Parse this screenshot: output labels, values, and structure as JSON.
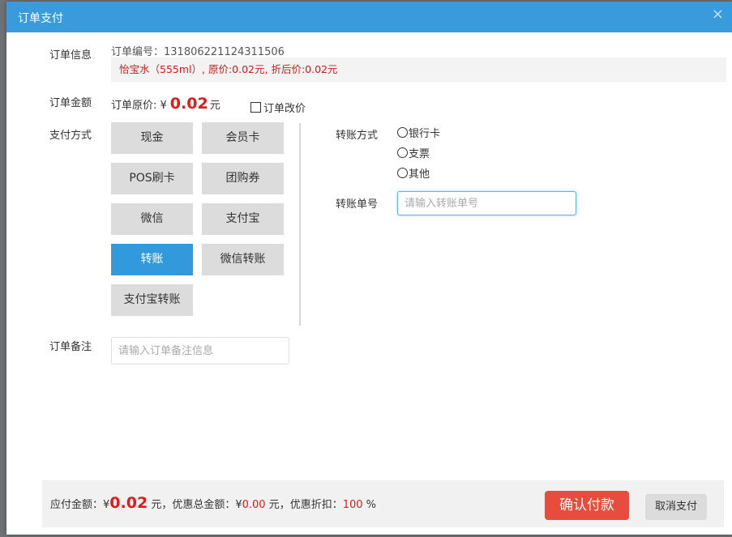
{
  "dialog": {
    "title": "订单支付",
    "close_icon": "×"
  },
  "order_info": {
    "label": "订单信息",
    "order_no_prefix": "订单编号：",
    "order_no": "131806221124311506",
    "goods_line": "怡宝水（555ml）, 原价:0.02元, 折后价:0.02元"
  },
  "order_amount": {
    "label": "订单金额",
    "original_label": "订单原价: ¥",
    "original_value": "0.02",
    "unit": "元",
    "modify_label": "订单改价"
  },
  "payment": {
    "label": "支付方式",
    "methods": [
      "现金",
      "会员卡",
      "POS刷卡",
      "团购券",
      "微信",
      "支付宝",
      "转账",
      "微信转账",
      "支付宝转账"
    ],
    "selected": "转账"
  },
  "transfer": {
    "method_label": "转账方式",
    "options": [
      "银行卡",
      "支票",
      "其他"
    ],
    "number_label": "转账单号",
    "number_placeholder": "请输入转账单号",
    "number_value": ""
  },
  "remark": {
    "label": "订单备注",
    "placeholder": "请输入订单备注信息",
    "value": ""
  },
  "footer": {
    "payable_label": "应付金额：¥",
    "payable_value": "0.02",
    "discount_label": "元，优惠总金额：¥",
    "discount_value": "0.00",
    "rate_label": "元，优惠折扣：",
    "rate_value": "100",
    "rate_unit": "%",
    "confirm_label": "确认付款",
    "cancel_label": "取消支付"
  },
  "colors": {
    "titlebar": "#3a9bdc",
    "active": "#3399dd",
    "accent_red": "#e31a1a",
    "confirm": "#e74c3c"
  }
}
